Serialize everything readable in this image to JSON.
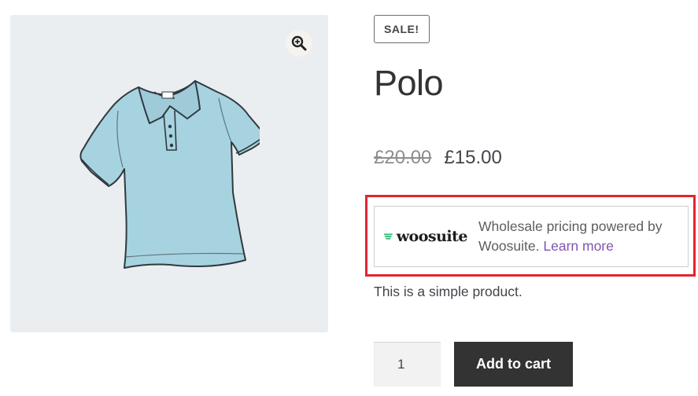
{
  "product": {
    "sale_badge": "SALE!",
    "title": "Polo",
    "price_regular": "£20.00",
    "price_sale": "£15.00",
    "description": "This is a simple product."
  },
  "gallery": {
    "image_icon": "polo-shirt-image",
    "zoom_icon": "zoom-in-icon"
  },
  "wholesale_notice": {
    "logo_text": "woosuite",
    "text": "Wholesale pricing powered by Woosuite.",
    "link_label": "Learn more"
  },
  "cart": {
    "quantity": "1",
    "add_to_cart_label": "Add to cart"
  },
  "colors": {
    "highlight_border": "#e0262f",
    "link": "#7f54b3",
    "button_bg": "#333333",
    "gallery_bg": "#ebeef1",
    "logo_green": "#2eb872",
    "shirt_fill": "#a6d3df"
  }
}
